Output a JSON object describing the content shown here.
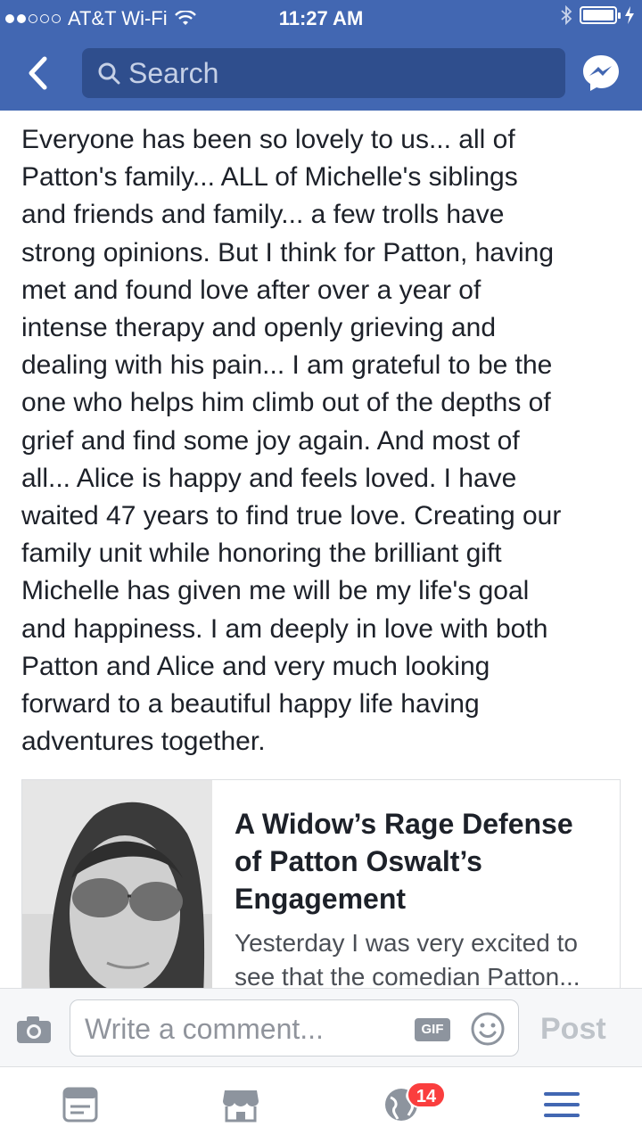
{
  "status_bar": {
    "carrier": "AT&T Wi-Fi",
    "time": "11:27 AM"
  },
  "nav": {
    "search_placeholder": "Search"
  },
  "post": {
    "text": "Everyone has been so lovely to us... all of\nPatton's family... ALL of Michelle's siblings\nand friends and family... a few trolls have\nstrong opinions. But I think for Patton, having\nmet and found love after over a year of\nintense therapy and openly grieving and\ndealing with his pain... I am grateful to be the\none who helps him climb out of the depths of\ngrief and find some joy again. And most of\nall... Alice is happy and feels loved.  I have\nwaited 47 years to find true love. Creating our\nfamily unit while honoring the brilliant gift\nMichelle has given me will be my life's goal\nand happiness. I am deeply in love with both\nPatton and Alice and very much looking\nforward to a beautiful happy life having\nadventures together."
  },
  "link_card": {
    "title": "A Widow’s Rage Defense of Patton Oswalt’s Engagement",
    "description": "Yesterday I was very excited to see that the comedian Patton..."
  },
  "comment_bar": {
    "placeholder": "Write a comment...",
    "gif_label": "GIF",
    "post_label": "Post"
  },
  "tab_bar": {
    "notifications_badge": "14"
  },
  "colors": {
    "brand": "#4267b2",
    "search_bg": "#2f4e8d",
    "badge": "#fa3e3e"
  }
}
